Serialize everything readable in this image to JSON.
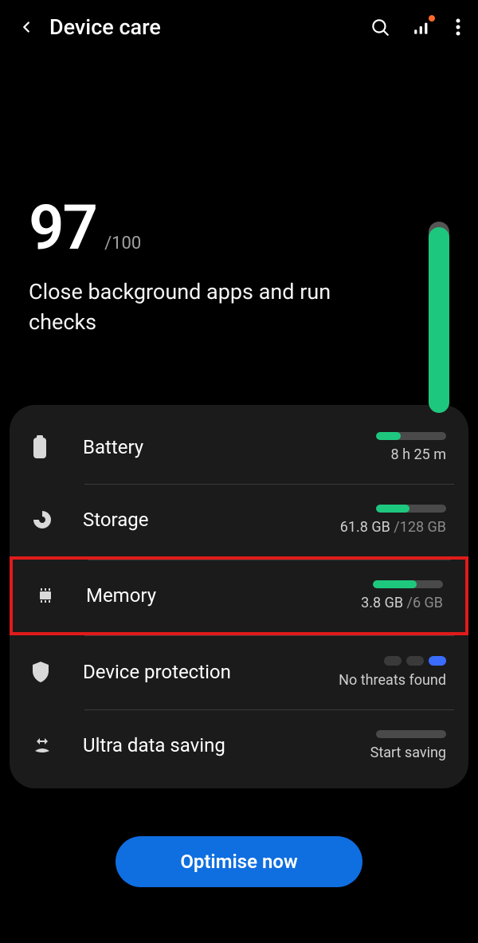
{
  "header": {
    "title": "Device care"
  },
  "score": {
    "value": "97",
    "max": "/100",
    "subtitle": "Close background apps and run checks",
    "percent": 97
  },
  "rows": {
    "battery": {
      "label": "Battery",
      "sub": "8 h 25 m",
      "progress": 35
    },
    "storage": {
      "label": "Storage",
      "sub_used": "61.8 GB ",
      "sub_total": "/128 GB",
      "progress": 48
    },
    "memory": {
      "label": "Memory",
      "sub_used": "3.8 GB ",
      "sub_total": "/6 GB",
      "progress": 63
    },
    "protection": {
      "label": "Device protection",
      "sub": "No threats found"
    },
    "data": {
      "label": "Ultra data saving",
      "sub": "Start saving"
    }
  },
  "cta": {
    "label": "Optimise now"
  }
}
